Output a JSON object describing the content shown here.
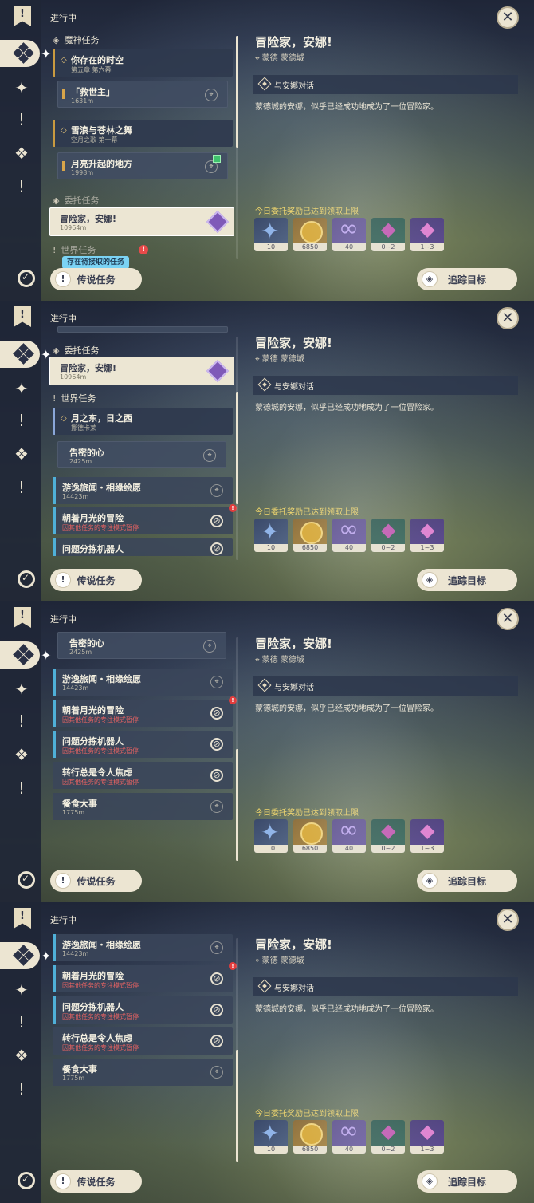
{
  "header": {
    "in_progress": "进行中"
  },
  "buttons": {
    "legend": "传说任务",
    "track": "追踪目标"
  },
  "detail": {
    "title": "冒险家，安娜!",
    "location": "蒙德 蒙德城",
    "objective": "与安娜对话",
    "description": "蒙德城的安娜，似乎已经成功地成为了一位冒险家。",
    "reward_limit": "今日委托奖励已达到领取上限",
    "rewards": [
      {
        "icon": "adventure-exp-icon",
        "count": "10"
      },
      {
        "icon": "mora-icon",
        "count": "6850"
      },
      {
        "icon": "friendship-exp-icon",
        "count": "40"
      },
      {
        "icon": "green-crystal-icon",
        "count": "0~2"
      },
      {
        "icon": "purple-crystal-icon",
        "count": "1~3"
      }
    ]
  },
  "sections": {
    "archon": "魔神任务",
    "commission": "委托任务",
    "world": "世界任务"
  },
  "tooltip": "存在待接取的任务",
  "quests": {
    "archon_main_1": {
      "title": "你存在的时空",
      "sub": "第五章 第六幕"
    },
    "archon_child_1": {
      "title": "「救世主」",
      "sub": "1631m"
    },
    "archon_main_2": {
      "title": "雪浪与苍林之舞",
      "sub": "空月之歌 第一幕"
    },
    "archon_child_2": {
      "title": "月亮升起的地方",
      "sub": "1998m"
    },
    "commission_1": {
      "title": "冒险家，安娜!",
      "sub": "10964m"
    },
    "world_main_1": {
      "title": "月之东，日之西",
      "sub": "挪德卡莱"
    },
    "world_child_1": {
      "title": "告密的心",
      "sub": "2425m"
    },
    "world_2": {
      "title": "游逸旅闻・相缘绘愿",
      "sub": "14423m"
    },
    "world_3": {
      "title": "朝着月光的冒险",
      "sub": "因其他任务的专注模式暂停"
    },
    "world_4": {
      "title": "问题分拣机器人",
      "sub": "因其他任务的专注模式暂停"
    },
    "world_5": {
      "title": "转行总是令人焦虑",
      "sub": "因其他任务的专注模式暂停"
    },
    "world_6": {
      "title": "餐食大事",
      "sub": "1775m"
    }
  },
  "colors": {
    "accent_gold": "#c99a40",
    "accent_blue": "#4fb0d8",
    "paused_red": "#e56262",
    "limit_yellow": "#f1d66a"
  }
}
